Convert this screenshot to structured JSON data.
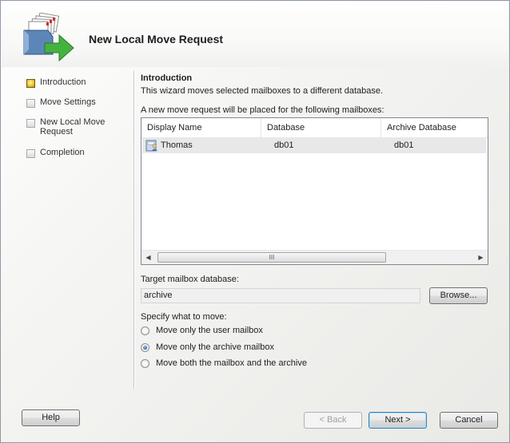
{
  "wizard": {
    "title": "New Local Move Request",
    "icon": "move-mailbox-icon"
  },
  "steps": [
    {
      "label": "Introduction",
      "active": true
    },
    {
      "label": "Move Settings",
      "active": false
    },
    {
      "label": "New Local Move Request",
      "active": false
    },
    {
      "label": "Completion",
      "active": false
    }
  ],
  "intro": {
    "title": "Introduction",
    "description": "This wizard moves selected mailboxes to a different database.",
    "list_caption": "A new move request will be placed for the following mailboxes:"
  },
  "mailboxes": {
    "columns": [
      "Display Name",
      "Database",
      "Archive Database"
    ],
    "rows": [
      {
        "display_name": "Thomas",
        "database": "db01",
        "archive_database": "db01",
        "icon": "mailbox-user-icon"
      }
    ],
    "scroll_grip": "III"
  },
  "target": {
    "label": "Target mailbox database:",
    "value": "archive",
    "browse_label": "Browse..."
  },
  "move_options": {
    "label": "Specify what to move:",
    "options": [
      {
        "label": "Move only the user mailbox",
        "selected": false
      },
      {
        "label": "Move only the archive mailbox",
        "selected": true
      },
      {
        "label": "Move both the mailbox and the archive",
        "selected": false
      }
    ]
  },
  "footer": {
    "help_label": "Help",
    "back_label": "< Back",
    "next_label": "Next >",
    "cancel_label": "Cancel"
  }
}
